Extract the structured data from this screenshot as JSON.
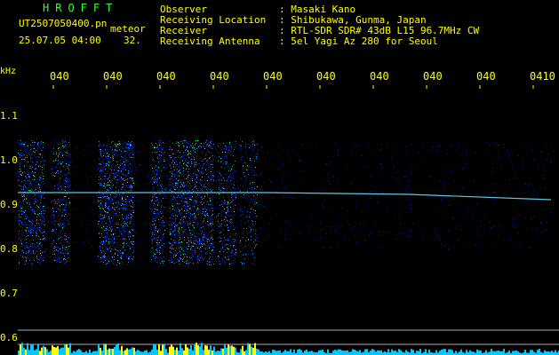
{
  "header": {
    "app_name": "HROFFT",
    "filename": "UT2507050400.pn",
    "meteor_label": "meteor",
    "datetime": "25.07.05 04:00",
    "meteor_count": "32."
  },
  "station": {
    "rows": [
      {
        "label": "Observer",
        "value": ": Masaki Kano"
      },
      {
        "label": "Receiving Location",
        "value": ": Shibukawa, Gunma, Japan"
      },
      {
        "label": "Receiver",
        "value": ": RTL-SDR SDR# 43dB L15 96.7MHz CW"
      },
      {
        "label": "Receiving Antenna",
        "value": ": 5el Yagi Az 280 for Seoul"
      }
    ]
  },
  "axis": {
    "y_unit": "kHz",
    "y_ticks": [
      "1.1",
      "1.0",
      "0.9",
      "0.8",
      "0.7",
      "0.6"
    ],
    "x_ticks": [
      "040",
      "040",
      "040",
      "040",
      "040",
      "040",
      "040",
      "040",
      "040",
      "0410"
    ]
  },
  "colors": {
    "text": "#ffff00",
    "title": "#33ff33",
    "background": "#000000",
    "signal_low": "#0022aa",
    "signal_mid": "#2a7bff",
    "signal_high": "#33ff66",
    "trace": "#66ddff",
    "level_bar": "#00c8ff",
    "level_peak": "#ffff00"
  }
}
